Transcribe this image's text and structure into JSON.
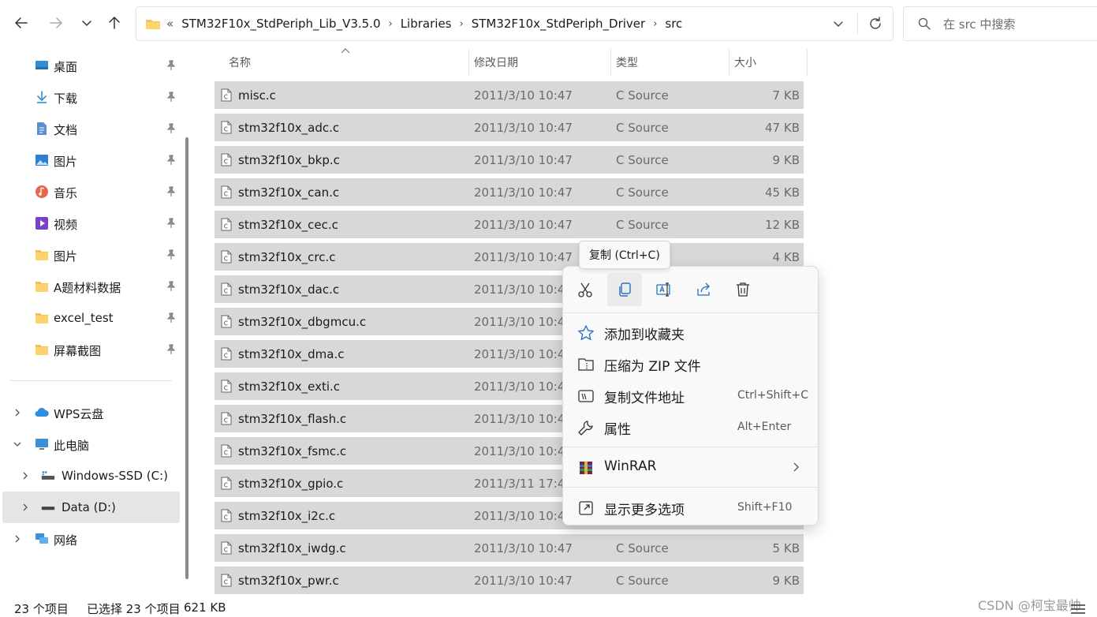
{
  "addressbar": {
    "overflow": "«",
    "crumbs": [
      "STM32F10x_StdPeriph_Lib_V3.5.0",
      "Libraries",
      "STM32F10x_StdPeriph_Driver",
      "src"
    ],
    "separator": "›"
  },
  "search": {
    "placeholder": "在 src 中搜索"
  },
  "sidebar": {
    "quick": [
      {
        "label": "桌面",
        "icon": "desktop-icon"
      },
      {
        "label": "下载",
        "icon": "download-icon"
      },
      {
        "label": "文档",
        "icon": "document-icon"
      },
      {
        "label": "图片",
        "icon": "pictures-icon"
      },
      {
        "label": "音乐",
        "icon": "music-icon"
      },
      {
        "label": "视频",
        "icon": "video-icon"
      },
      {
        "label": "图片",
        "icon": "folder-icon"
      },
      {
        "label": "A题材料数据",
        "icon": "folder-icon"
      },
      {
        "label": "excel_test",
        "icon": "folder-icon"
      },
      {
        "label": "屏幕截图",
        "icon": "folder-icon"
      }
    ],
    "tree": [
      {
        "label": "WPS云盘",
        "icon": "cloud-icon"
      },
      {
        "label": "此电脑",
        "icon": "computer-icon"
      },
      {
        "label": "Windows-SSD (C:)",
        "icon": "drive-icon"
      },
      {
        "label": "Data (D:)",
        "icon": "drive-icon"
      },
      {
        "label": "网络",
        "icon": "network-icon"
      }
    ]
  },
  "columns": {
    "name": "名称",
    "date": "修改日期",
    "type": "类型",
    "size": "大小"
  },
  "files": [
    {
      "name": "misc.c",
      "date": "2011/3/10 10:47",
      "type": "C Source",
      "size": "7 KB"
    },
    {
      "name": "stm32f10x_adc.c",
      "date": "2011/3/10 10:47",
      "type": "C Source",
      "size": "47 KB"
    },
    {
      "name": "stm32f10x_bkp.c",
      "date": "2011/3/10 10:47",
      "type": "C Source",
      "size": "9 KB"
    },
    {
      "name": "stm32f10x_can.c",
      "date": "2011/3/10 10:47",
      "type": "C Source",
      "size": "45 KB"
    },
    {
      "name": "stm32f10x_cec.c",
      "date": "2011/3/10 10:47",
      "type": "C Source",
      "size": "12 KB"
    },
    {
      "name": "stm32f10x_crc.c",
      "date": "2011/3/10 10:47",
      "type": "",
      "size": "4 KB"
    },
    {
      "name": "stm32f10x_dac.c",
      "date": "2011/3/10 10:4",
      "type": "",
      "size": ""
    },
    {
      "name": "stm32f10x_dbgmcu.c",
      "date": "2011/3/10 10:4",
      "type": "",
      "size": ""
    },
    {
      "name": "stm32f10x_dma.c",
      "date": "2011/3/10 10:4",
      "type": "",
      "size": ""
    },
    {
      "name": "stm32f10x_exti.c",
      "date": "2011/3/10 10:4",
      "type": "",
      "size": ""
    },
    {
      "name": "stm32f10x_flash.c",
      "date": "2011/3/10 10:4",
      "type": "",
      "size": ""
    },
    {
      "name": "stm32f10x_fsmc.c",
      "date": "2011/3/10 10:4",
      "type": "",
      "size": ""
    },
    {
      "name": "stm32f10x_gpio.c",
      "date": "2011/3/11 17:4",
      "type": "",
      "size": ""
    },
    {
      "name": "stm32f10x_i2c.c",
      "date": "2011/3/10 10:4",
      "type": "",
      "size": ""
    },
    {
      "name": "stm32f10x_iwdg.c",
      "date": "2011/3/10 10:47",
      "type": "C Source",
      "size": "5 KB"
    },
    {
      "name": "stm32f10x_pwr.c",
      "date": "2011/3/10 10:47",
      "type": "C Source",
      "size": "9 KB"
    }
  ],
  "tooltip": "复制 (Ctrl+C)",
  "context_menu": {
    "quick_actions": [
      "cut-icon",
      "copy-icon",
      "rename-icon",
      "share-icon",
      "delete-icon"
    ],
    "items": [
      {
        "label": "添加到收藏夹",
        "shortcut": "",
        "icon": "star-icon"
      },
      {
        "label": "压缩为 ZIP 文件",
        "shortcut": "",
        "icon": "zip-icon"
      },
      {
        "label": "复制文件地址",
        "shortcut": "Ctrl+Shift+C",
        "icon": "path-icon"
      },
      {
        "label": "属性",
        "shortcut": "Alt+Enter",
        "icon": "wrench-icon"
      },
      {
        "label": "WinRAR",
        "shortcut": "",
        "icon": "winrar-icon"
      },
      {
        "label": "显示更多选项",
        "shortcut": "Shift+F10",
        "icon": "more-options-icon"
      }
    ]
  },
  "status": {
    "count": "23 个项目",
    "selected": "已选择 23 个项目",
    "size": "621 KB"
  },
  "watermark": "CSDN @柯宝最帅"
}
